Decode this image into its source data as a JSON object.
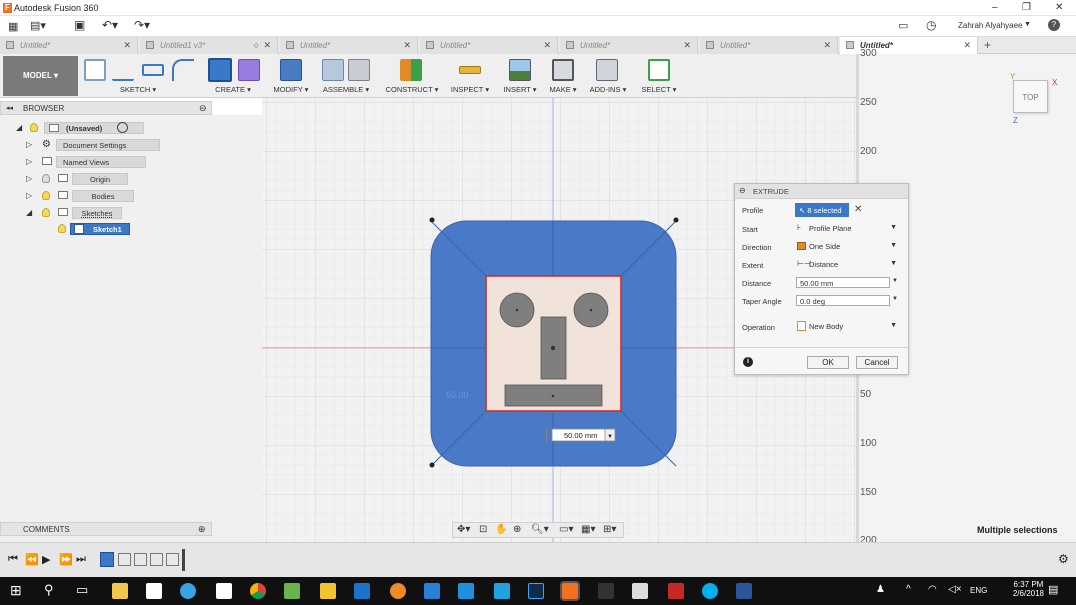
{
  "window": {
    "title": "Autodesk Fusion 360"
  },
  "appbar": {
    "user": "Zahrah Alyahyaee",
    "help": "?"
  },
  "tabs": [
    {
      "label": "Untitled*",
      "active": false
    },
    {
      "label": "Untitled1 v3*",
      "active": false
    },
    {
      "label": "Untitled*",
      "active": false
    },
    {
      "label": "Untitled*",
      "active": false
    },
    {
      "label": "Untitled*",
      "active": false
    },
    {
      "label": "Untitled*",
      "active": false
    },
    {
      "label": "Untitled*",
      "active": true
    }
  ],
  "toolbar": {
    "workspace": "MODEL",
    "groups": [
      "SKETCH",
      "CREATE",
      "MODIFY",
      "ASSEMBLE",
      "CONSTRUCT",
      "INSPECT",
      "INSERT",
      "MAKE",
      "ADD-INS",
      "SELECT"
    ]
  },
  "browser": {
    "title": "BROWSER",
    "root": "(Unsaved)",
    "items": [
      "Document Settings",
      "Named Views",
      "Origin",
      "Bodies",
      "Sketches",
      "Sketch1"
    ]
  },
  "comments": {
    "title": "COMMENTS"
  },
  "viewcube": {
    "face": "TOP",
    "x_label": "X",
    "y_label": "Y",
    "z_label": "Z"
  },
  "ruler": {
    "ticks": [
      "300",
      "250",
      "200",
      "50",
      "100",
      "150",
      "200"
    ]
  },
  "canvas": {
    "dim_label": "50.00",
    "dim_input": "50.00 mm"
  },
  "extrude": {
    "title": "EXTRUDE",
    "profile_label": "Profile",
    "profile_value": "8 selected",
    "start_label": "Start",
    "start_value": "Profile Plane",
    "direction_label": "Direction",
    "direction_value": "One Side",
    "extent_label": "Extent",
    "extent_value": "Distance",
    "distance_label": "Distance",
    "distance_value": "50.00 mm",
    "taper_label": "Taper Angle",
    "taper_value": "0.0 deg",
    "operation_label": "Operation",
    "operation_value": "New Body",
    "ok": "OK",
    "cancel": "Cancel"
  },
  "status": {
    "right": "Multiple selections"
  },
  "taskbar": {
    "time": "6:37 PM",
    "date": "2/6/2018",
    "lang": "ENG"
  }
}
